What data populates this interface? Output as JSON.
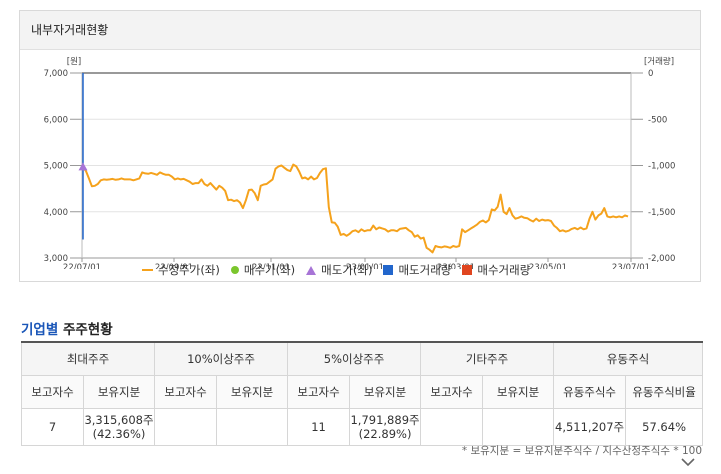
{
  "panel": {
    "title": "내부자거래현황"
  },
  "chart_data": {
    "type": "line",
    "left_axis": {
      "label": "[원]",
      "ticks": [
        "7,000",
        "6,000",
        "5,000",
        "4,000",
        "3,000"
      ],
      "range": [
        3000,
        7000
      ]
    },
    "right_axis": {
      "label": "[거래량]",
      "ticks": [
        "0",
        "-500",
        "-1,000",
        "-1,500",
        "-2,000"
      ],
      "range": [
        -2000,
        0
      ]
    },
    "x_ticks": [
      "22/07/01",
      "22/09/01",
      "22/11/01",
      "23/01/01",
      "23/03/01",
      "23/05/01",
      "23/07/01"
    ],
    "series": [
      {
        "name": "수정주가(좌)",
        "color": "#f5a21c",
        "values": [
          4960,
          4880,
          4720,
          4550,
          4560,
          4600,
          4680,
          4700,
          4690,
          4700,
          4710,
          4690,
          4700,
          4720,
          4700,
          4700,
          4700,
          4680,
          4700,
          4720,
          4850,
          4830,
          4820,
          4840,
          4820,
          4800,
          4850,
          4820,
          4800,
          4800,
          4760,
          4700,
          4720,
          4700,
          4710,
          4680,
          4650,
          4600,
          4620,
          4620,
          4700,
          4600,
          4560,
          4620,
          4550,
          4480,
          4560,
          4520,
          4450,
          4250,
          4260,
          4230,
          4250,
          4200,
          4080,
          4250,
          4470,
          4480,
          4400,
          4250,
          4560,
          4590,
          4600,
          4650,
          4700,
          4930,
          4980,
          5000,
          4950,
          4900,
          4880,
          5020,
          4980,
          4870,
          4720,
          4740,
          4700,
          4760,
          4700,
          4730,
          4840,
          4920,
          4940,
          4100,
          3770,
          3760,
          3680,
          3500,
          3520,
          3480,
          3520,
          3580,
          3600,
          3560,
          3620,
          3580,
          3600,
          3600,
          3700,
          3620,
          3660,
          3640,
          3620,
          3570,
          3600,
          3600,
          3580,
          3630,
          3640,
          3650,
          3600,
          3560,
          3460,
          3490,
          3420,
          3440,
          3220,
          3180,
          3120,
          3260,
          3240,
          3230,
          3250,
          3240,
          3220,
          3260,
          3240,
          3260,
          3620,
          3560,
          3600,
          3640,
          3680,
          3720,
          3780,
          3810,
          3770,
          3820,
          4050,
          4030,
          4110,
          4370,
          4000,
          3950,
          4080,
          3920,
          3850,
          3870,
          3900,
          3870,
          3860,
          3820,
          3790,
          3850,
          3800,
          3830,
          3810,
          3820,
          3800,
          3700,
          3650,
          3580,
          3600,
          3570,
          3590,
          3630,
          3650,
          3620,
          3660,
          3620,
          3640,
          3850,
          4000,
          3830,
          3920,
          3960,
          4080,
          3900,
          3880,
          3900,
          3880,
          3900,
          3880,
          3920,
          3900
        ]
      },
      {
        "name": "매수가(좌)",
        "color": "#7bc62d",
        "values": []
      },
      {
        "name": "매도가(좌)",
        "color": "#a774d6",
        "points": [
          {
            "x": "22/07/01",
            "y": 4960
          }
        ]
      },
      {
        "name": "매도거래량",
        "color": "#2266cc",
        "points": [
          {
            "x": "22/07/01",
            "y": -1800
          }
        ]
      },
      {
        "name": "매수거래량",
        "color": "#e0451f",
        "values": []
      }
    ]
  },
  "section": {
    "title_accent": "기업별",
    "title_rest": " 주주현황"
  },
  "table": {
    "groups": [
      "최대주주",
      "10%이상주주",
      "5%이상주주",
      "기타주주",
      "유동주식"
    ],
    "subheaders": [
      "보고자수",
      "보유지분",
      "보고자수",
      "보유지분",
      "보고자수",
      "보유지분",
      "보고자수",
      "보유지분",
      "유동주식수",
      "유동주식비율"
    ],
    "row": {
      "c1": "7",
      "c2_a": "3,315,608주",
      "c2_b": "(42.36%)",
      "c3": "",
      "c4": "",
      "c5": "11",
      "c6_a": "1,791,889주",
      "c6_b": "(22.89%)",
      "c7": "",
      "c8": "",
      "c9": "4,511,207주",
      "c10": "57.64%"
    }
  },
  "footnote": "* 보유지분 = 보유지분주식수 / 지수산정주식수 * 100"
}
